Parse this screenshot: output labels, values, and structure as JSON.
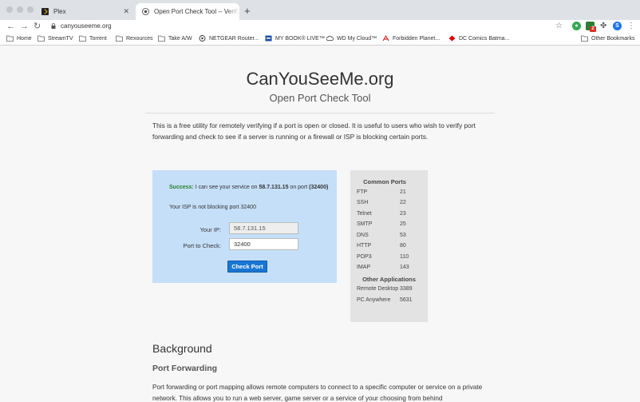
{
  "browser": {
    "tabs": [
      {
        "title": "Plex",
        "icon": "plex-icon",
        "active": false
      },
      {
        "title": "Open Port Check Tool -- Verify Port Forwarding on Your Router",
        "icon": "canyouseeme-icon",
        "active": true
      }
    ],
    "new_tab_symbol": "+",
    "close_symbol": "✕",
    "url": "canyouseeme.org",
    "bookmarks": [
      {
        "label": "Home",
        "icon": "folder-icon"
      },
      {
        "label": "StreamTV",
        "icon": "folder-icon"
      },
      {
        "label": "Torrent",
        "icon": "folder-icon"
      },
      {
        "label": "Rexources",
        "icon": "folder-icon"
      },
      {
        "label": "Take A/W",
        "icon": "folder-icon"
      },
      {
        "label": "NETGEAR Router...",
        "icon": "netgear-icon"
      },
      {
        "label": "MY BOOK® LIVE™",
        "icon": "wd-mybook-icon"
      },
      {
        "label": "WD My Cloud™",
        "icon": "wd-cloud-icon"
      },
      {
        "label": "Forbidden Planet...",
        "icon": "forbidden-planet-icon"
      },
      {
        "label": "DC Comics Batma...",
        "icon": "dc-comics-icon"
      }
    ],
    "other_bookmarks": "Other Bookmarks",
    "extension_badge": "2",
    "profile_initial": "S",
    "colors": {
      "tabstrip": "#dee1e6",
      "profile": "#1a73e8",
      "extension": "#34a853",
      "badge": "#d93025"
    }
  },
  "site": {
    "title": "CanYouSeeMe.org",
    "subtitle": "Open Port Check Tool",
    "intro": "This is a free utility for remotely verifying if a port is open or closed. It is useful to users who wish to verify port forwarding and check to see if a server is running or a firewall or ISP is blocking certain ports."
  },
  "check": {
    "success_label": "Success:",
    "success_text": "I can see your service on",
    "ip": "58.7.131.15",
    "on_port": "on port",
    "port_paren": "(32400)",
    "isp_text": "Your ISP is not blocking port 32400",
    "ip_label": "Your IP:",
    "ip_value": "58.7.131.15",
    "port_label": "Port to Check:",
    "port_value": "32400",
    "button": "Check Port",
    "colors": {
      "panel": "#c5dff8",
      "success": "#2a7d2a",
      "button": "#1976d2"
    }
  },
  "common_ports": {
    "heading": "Common Ports",
    "rows": [
      {
        "name": "FTP",
        "port": "21"
      },
      {
        "name": "SSH",
        "port": "22"
      },
      {
        "name": "Telnet",
        "port": "23"
      },
      {
        "name": "SMTP",
        "port": "25"
      },
      {
        "name": "DNS",
        "port": "53"
      },
      {
        "name": "HTTP",
        "port": "80"
      },
      {
        "name": "POP3",
        "port": "110"
      },
      {
        "name": "IMAP",
        "port": "143"
      }
    ],
    "apps_heading": "Other Applications",
    "apps": [
      {
        "name": "Remote Desktop",
        "port": "3389"
      },
      {
        "name": "PC Anywhere",
        "port": "5631"
      }
    ]
  },
  "content": {
    "background_heading": "Background",
    "pf_heading": "Port Forwarding",
    "pf_text": "Port forwarding or port mapping allows remote computers to connect to a specific computer or service on a private network. This allows you to run a web server, game server or a service of your choosing from behind"
  }
}
